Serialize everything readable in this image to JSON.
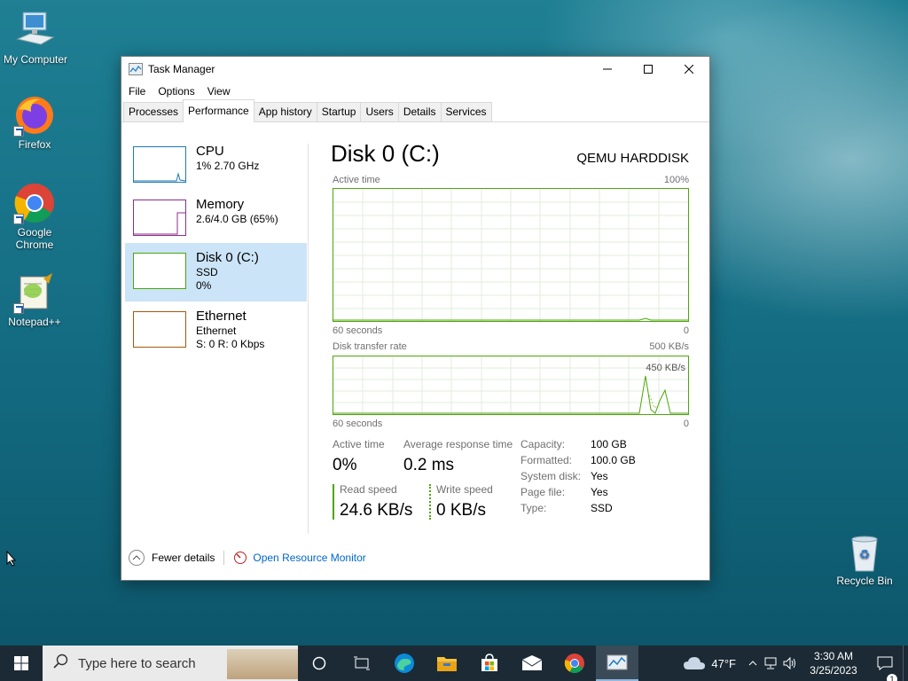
{
  "desktop": {
    "icons": [
      {
        "label": "My Computer"
      },
      {
        "label": "Firefox"
      },
      {
        "label": "Google Chrome"
      },
      {
        "label": "Notepad++"
      },
      {
        "label": "Recycle Bin"
      }
    ]
  },
  "window": {
    "title": "Task Manager",
    "menu": [
      "File",
      "Options",
      "View"
    ],
    "tabs": [
      "Processes",
      "Performance",
      "App history",
      "Startup",
      "Users",
      "Details",
      "Services"
    ],
    "active_tab": "Performance"
  },
  "resources": [
    {
      "name": "CPU",
      "sub1": "1% 2.70 GHz",
      "sub2": "",
      "color": "#1c7ab8"
    },
    {
      "name": "Memory",
      "sub1": "2.6/4.0 GB (65%)",
      "sub2": "",
      "color": "#8b2e8b"
    },
    {
      "name": "Disk 0 (C:)",
      "sub1": "SSD",
      "sub2": "0%",
      "color": "#4da60c"
    },
    {
      "name": "Ethernet",
      "sub1": "Ethernet",
      "sub2": "S: 0 R: 0 Kbps",
      "color": "#a7560d"
    }
  ],
  "disk": {
    "title": "Disk 0 (C:)",
    "model": "QEMU HARDDISK",
    "active_time_label": "Active time",
    "active_time_max": "100%",
    "graph1_left": "60 seconds",
    "graph1_right": "0",
    "transfer_label": "Disk transfer rate",
    "transfer_max": "500 KB/s",
    "transfer_mid": "450 KB/s",
    "graph2_left": "60 seconds",
    "graph2_right": "0",
    "stats": {
      "active_time_label": "Active time",
      "active_time": "0%",
      "avg_resp_label": "Average response time",
      "avg_resp": "0.2 ms",
      "read_label": "Read speed",
      "read": "24.6 KB/s",
      "write_label": "Write speed",
      "write": "0 KB/s"
    },
    "props": [
      {
        "k": "Capacity:",
        "v": "100 GB"
      },
      {
        "k": "Formatted:",
        "v": "100.0 GB"
      },
      {
        "k": "System disk:",
        "v": "Yes"
      },
      {
        "k": "Page file:",
        "v": "Yes"
      },
      {
        "k": "Type:",
        "v": "SSD"
      }
    ]
  },
  "footer": {
    "fewer": "Fewer details",
    "monitor": "Open Resource Monitor"
  },
  "taskbar": {
    "search_placeholder": "Type here to search",
    "weather": "47°F",
    "time": "3:30 AM",
    "date": "3/25/2023",
    "notif_count": "1"
  }
}
